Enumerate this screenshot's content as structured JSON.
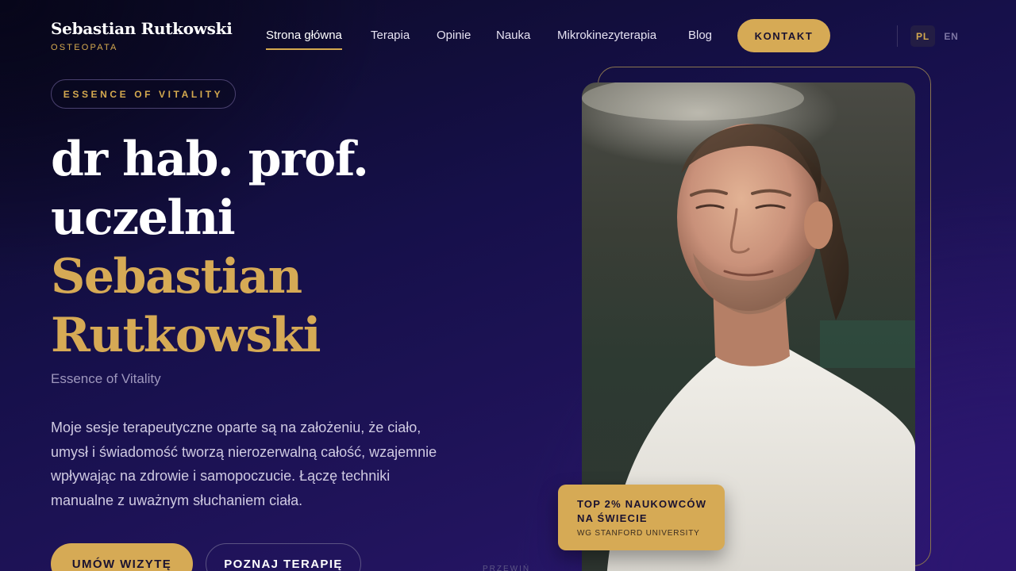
{
  "brand": {
    "name": "Sebastian Rutkowski",
    "subtitle": "OSTEOPATA"
  },
  "nav": {
    "items": [
      {
        "label": "Strona główna",
        "active": true
      },
      {
        "label": "Terapia"
      },
      {
        "label": "Opinie"
      },
      {
        "label": "Nauka"
      },
      {
        "label": "Mikrokinezyterapia"
      },
      {
        "label": "Blog"
      }
    ],
    "contact_label": "KONTAKT"
  },
  "languages": [
    {
      "code": "PL",
      "active": true
    },
    {
      "code": "EN"
    }
  ],
  "hero": {
    "badge": "ESSENCE OF VITALITY",
    "title_line1": "dr hab. prof.",
    "title_line2": "uczelni",
    "name_line1": "Sebastian",
    "name_line2": "Rutkowski",
    "tagline": "Essence of Vitality",
    "description": "Moje sesje terapeutyczne oparte są na założeniu, że ciało, umysł i świadomość tworzą nierozerwalną całość, wzajemnie wpływając na zdrowie i samopoczucie. Łączę techniki manualne z uważnym słuchaniem ciała.",
    "primary_button": "UMÓW WIZYTĘ",
    "secondary_button": "POZNAJ TERAPIĘ",
    "scroll_hint": "PRZEWIŃ"
  },
  "award": {
    "title": "TOP 2% NAUKOWCÓW NA ŚWIECIE",
    "subtitle": "WG STANFORD UNIVERSITY"
  },
  "colors": {
    "accent_gold": "#d6aa55",
    "background_deep": "#0b0a24",
    "background_purple": "#2a1872"
  }
}
